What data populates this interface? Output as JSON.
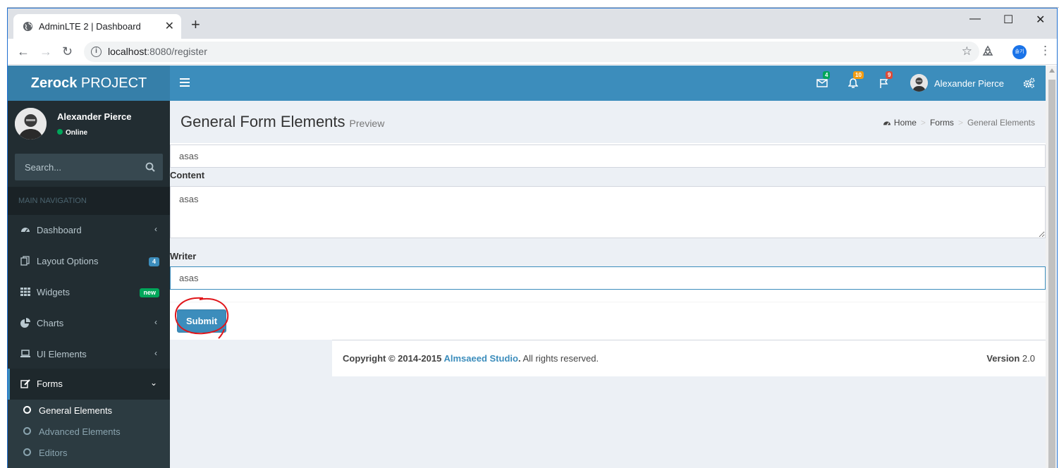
{
  "browser": {
    "tab_title": "AdminLTE 2 | Dashboard",
    "url_host": "localhost",
    "url_path": ":8080/register",
    "profile_label": "솔기"
  },
  "header": {
    "logo_bold": "Zerock",
    "logo_rest": " PROJECT",
    "messages_count": "4",
    "notifications_count": "10",
    "tasks_count": "9",
    "user_name": "Alexander Pierce"
  },
  "sidebar": {
    "user_name": "Alexander Pierce",
    "status": "Online",
    "search_placeholder": "Search...",
    "nav_header": "MAIN NAVIGATION",
    "items": [
      {
        "label": "Dashboard",
        "icon": "dashboard-icon"
      },
      {
        "label": "Layout Options",
        "icon": "files-icon",
        "badge": "4"
      },
      {
        "label": "Widgets",
        "icon": "th-icon",
        "badge": "new"
      },
      {
        "label": "Charts",
        "icon": "pie-chart-icon"
      },
      {
        "label": "UI Elements",
        "icon": "laptop-icon"
      },
      {
        "label": "Forms",
        "icon": "edit-icon"
      }
    ],
    "subitems": [
      {
        "label": "General Elements"
      },
      {
        "label": "Advanced Elements"
      },
      {
        "label": "Editors"
      }
    ]
  },
  "content": {
    "title": "General Form Elements",
    "subtitle": "Preview",
    "breadcrumb": [
      "Home",
      "Forms",
      "General Elements"
    ]
  },
  "form": {
    "title_value": "asas",
    "content_label": "Content",
    "content_value": "asas",
    "writer_label": "Writer",
    "writer_value": "asas",
    "submit_label": "Submit"
  },
  "footer": {
    "copyright_prefix": "Copyright © 2014-2015 ",
    "company": "Almsaeed Studio",
    "copyright_suffix": ". All rights reserved.",
    "version_label": "Version",
    "version_value": " 2.0"
  },
  "colors": {
    "primary": "#3c8dbc",
    "sidebar_bg": "#222d32",
    "success": "#00a65a",
    "warning": "#f39c12",
    "danger": "#dd4b39"
  }
}
